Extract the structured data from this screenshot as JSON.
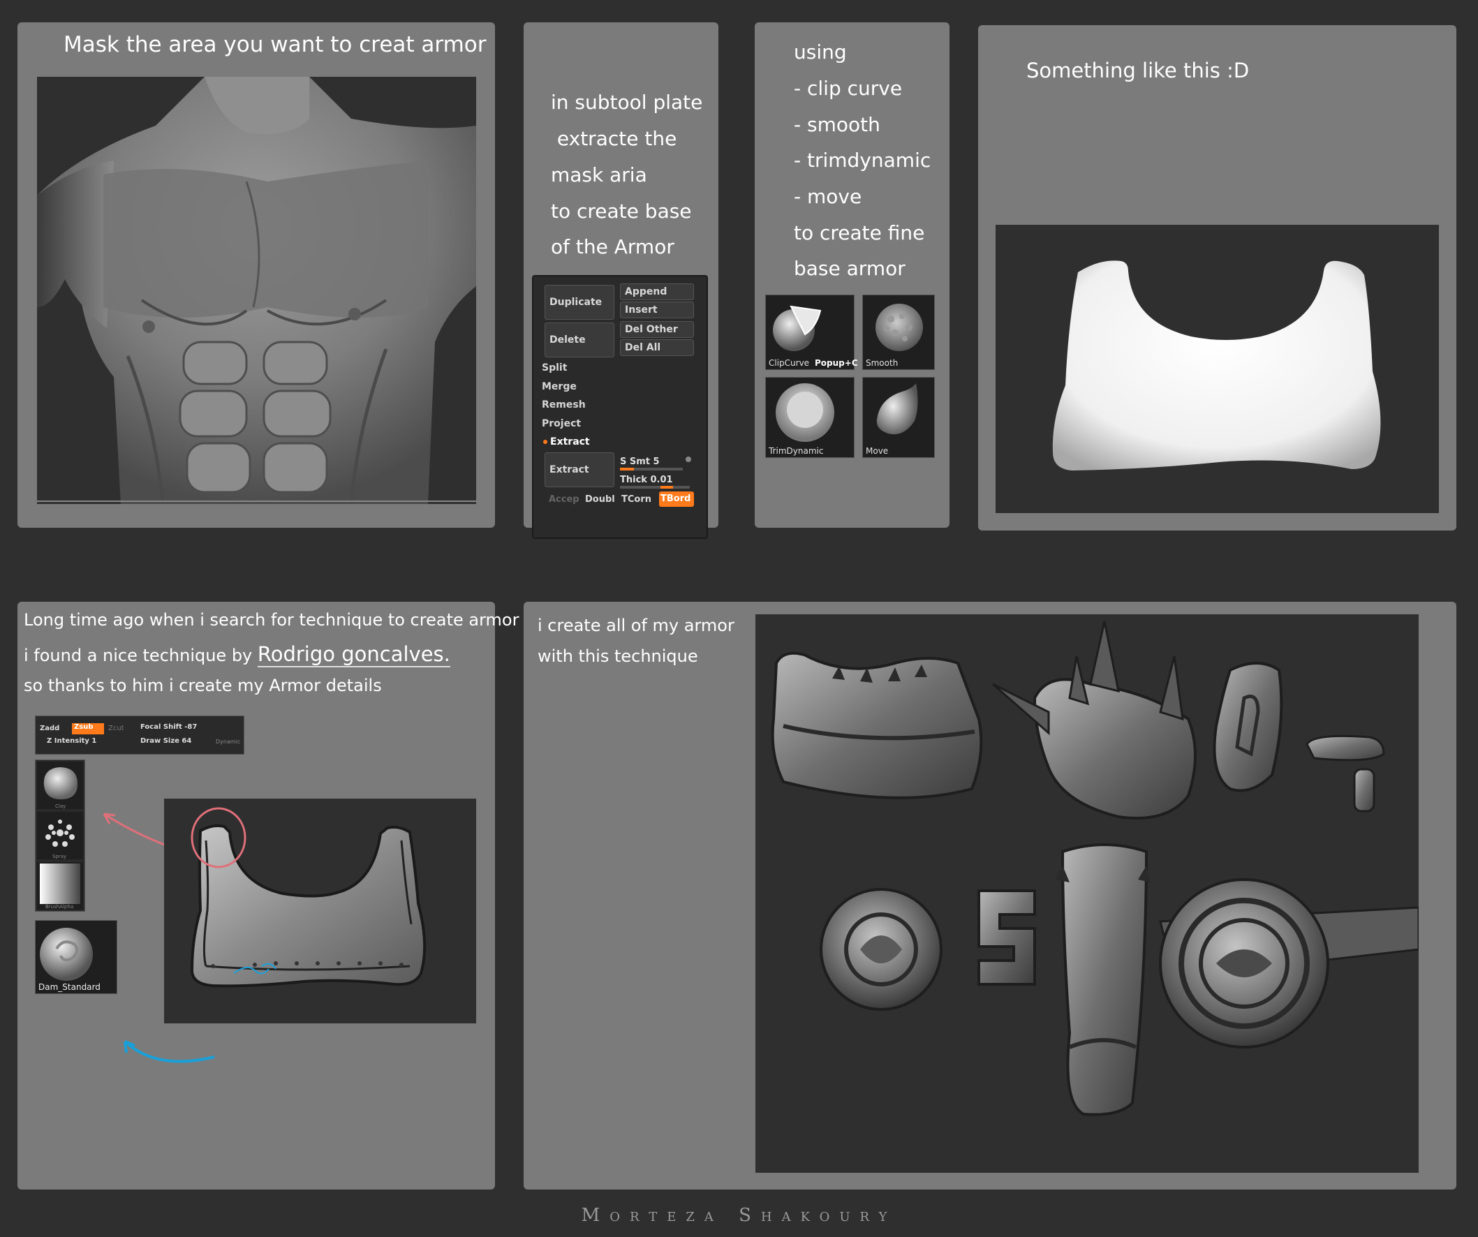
{
  "panel1": {
    "title": "Mask the area you want to creat armor"
  },
  "panel2": {
    "lines": [
      "in subtool plate",
      " extracte the",
      "mask aria",
      "to create base",
      "of the Armor"
    ],
    "subtool_menu": {
      "duplicate": "Duplicate",
      "append": "Append",
      "insert": "Insert",
      "delete": "Delete",
      "del_other": "Del Other",
      "del_all": "Del All",
      "split": "Split",
      "merge": "Merge",
      "remesh": "Remesh",
      "project": "Project",
      "extract_header": "Extract",
      "extract_button": "Extract",
      "s_smt": "S Smt 5",
      "thick": "Thick 0.01",
      "accept": "Accep",
      "double": "Doubl",
      "tcorner": "TCorn",
      "tborder": "TBord"
    }
  },
  "panel3": {
    "lines": [
      "using",
      "- clip curve",
      "- smooth",
      "- trimdynamic",
      "- move",
      "to create fine",
      "base armor"
    ],
    "brushes": {
      "clipcurve": "ClipCurve",
      "popup": "Popup+C",
      "smooth": "Smooth",
      "trimdynamic": "TrimDynamic",
      "move": "Move"
    }
  },
  "panel4": {
    "text": "Something like this :D"
  },
  "panel5": {
    "line1": "Long time ago when i search for technique to create armor",
    "line2_prefix": "i found a nice technique by ",
    "line2_name": "Rodrigo goncalves.",
    "line3": "so thanks to him i create my Armor details",
    "toolbar": {
      "zadd": "Zadd",
      "zsub": "Zsub",
      "zcut": "Zcut",
      "focal_shift": "Focal Shift -87",
      "z_intensity": "Z Intensity 1",
      "draw_size": "Draw Size 64",
      "dynamic": "Dynamic"
    },
    "brushes": {
      "clay": "Clay",
      "spray": "Spray",
      "brushalpha": "BrushAlpha",
      "dam_standard": "Dam_Standard"
    }
  },
  "panel6": {
    "line1": "i create all of my armor",
    "line2": "with this technique"
  },
  "signature": "Morteza Shakoury",
  "colors": {
    "background": "#2f2f2f",
    "panel": "#7b7b7b",
    "zbrush_orange": "#ff7a1a",
    "annotation_red": "#e0707a",
    "annotation_blue": "#1aa0d8"
  }
}
